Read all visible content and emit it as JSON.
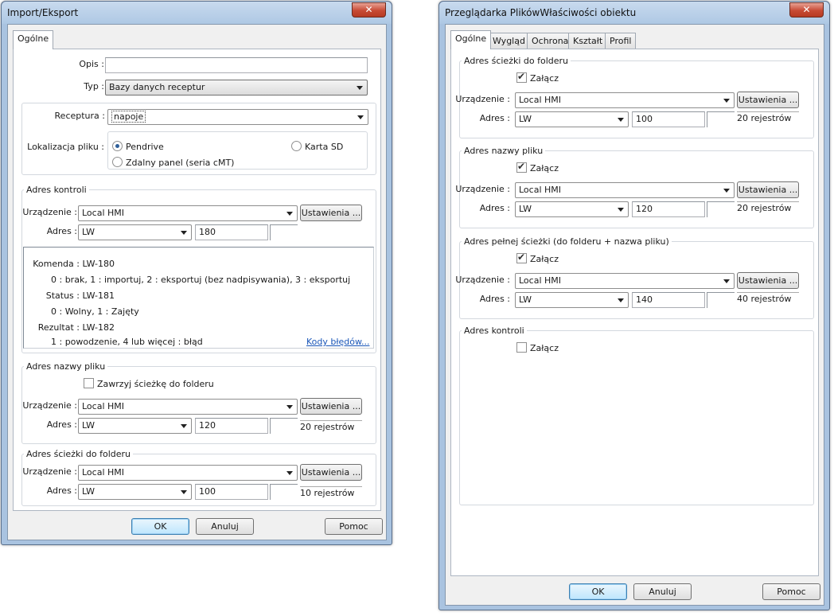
{
  "left_window": {
    "title": "Import/Eksport",
    "close_label": "✕",
    "tab": "Ogólne",
    "opis_label": "Opis :",
    "opis_value": "",
    "typ_label": "Typ :",
    "typ_value": "Bazy danych receptur",
    "receptura_label": "Receptura :",
    "receptura_value": "napoje",
    "lokalizacja_label": "Lokalizacja pliku :",
    "radio_pendrive": "Pendrive",
    "radio_karta": "Karta SD",
    "radio_zdalny": "Zdalny panel (seria cMT)",
    "adres_kontroli": {
      "group": "Adres kontroli",
      "urzadzenie_label": "Urządzenie :",
      "urzadzenie_value": "Local HMI",
      "ustawienia": "Ustawienia ...",
      "adres_label": "Adres :",
      "adres_type": "LW",
      "adres_value": "180"
    },
    "info": {
      "komenda": "Komenda : LW-180",
      "komenda_desc": "0 : brak, 1 : importuj, 2 : eksportuj (bez nadpisywania), 3 : eksportuj",
      "status": "Status : LW-181",
      "status_desc": "0 : Wolny, 1 : Zajęty",
      "rezultat": "Rezultat : LW-182",
      "rezultat_desc": "1 : powodzenie, 4 lub więcej : błąd",
      "link": "Kody błędów..."
    },
    "adres_nazwy": {
      "group": "Adres nazwy pliku",
      "checkbox": "Zawrzyj ścieżkę do folderu",
      "urzadzenie_label": "Urządzenie :",
      "urzadzenie_value": "Local HMI",
      "ustawienia": "Ustawienia ...",
      "adres_label": "Adres :",
      "adres_type": "LW",
      "adres_value": "120",
      "rejestrow": "20 rejestrów"
    },
    "adres_sciezki": {
      "group": "Adres ścieżki do folderu",
      "urzadzenie_label": "Urządzenie :",
      "urzadzenie_value": "Local HMI",
      "ustawienia": "Ustawienia ...",
      "adres_label": "Adres :",
      "adres_type": "LW",
      "adres_value": "100",
      "rejestrow": "10 rejestrów"
    },
    "ok": "OK",
    "anuluj": "Anuluj",
    "pomoc": "Pomoc"
  },
  "right_window": {
    "title": "Przeglądarka PlikówWłaściwości obiektu",
    "close_label": "✕",
    "tabs": [
      "Ogólne",
      "Wygląd",
      "Ochrona",
      "Kształt",
      "Profil"
    ],
    "g1": {
      "group": "Adres ścieżki do folderu",
      "zalacz": "Załącz",
      "urzadzenie_label": "Urządzenie :",
      "urzadzenie_value": "Local HMI",
      "ustawienia": "Ustawienia ...",
      "adres_label": "Adres :",
      "adres_type": "LW",
      "adres_value": "100",
      "rejestrow": "20 rejestrów"
    },
    "g2": {
      "group": "Adres nazwy pliku",
      "zalacz": "Załącz",
      "urzadzenie_label": "Urządzenie :",
      "urzadzenie_value": "Local HMI",
      "ustawienia": "Ustawienia ...",
      "adres_label": "Adres :",
      "adres_type": "LW",
      "adres_value": "120",
      "rejestrow": "20 rejestrów"
    },
    "g3": {
      "group": "Adres pełnej ścieżki (do folderu + nazwa pliku)",
      "zalacz": "Załącz",
      "urzadzenie_label": "Urządzenie :",
      "urzadzenie_value": "Local HMI",
      "ustawienia": "Ustawienia ...",
      "adres_label": "Adres :",
      "adres_type": "LW",
      "adres_value": "140",
      "rejestrow": "40 rejestrów"
    },
    "g4": {
      "group": "Adres kontroli",
      "zalacz": "Załącz"
    },
    "ok": "OK",
    "anuluj": "Anuluj",
    "pomoc": "Pomoc"
  }
}
